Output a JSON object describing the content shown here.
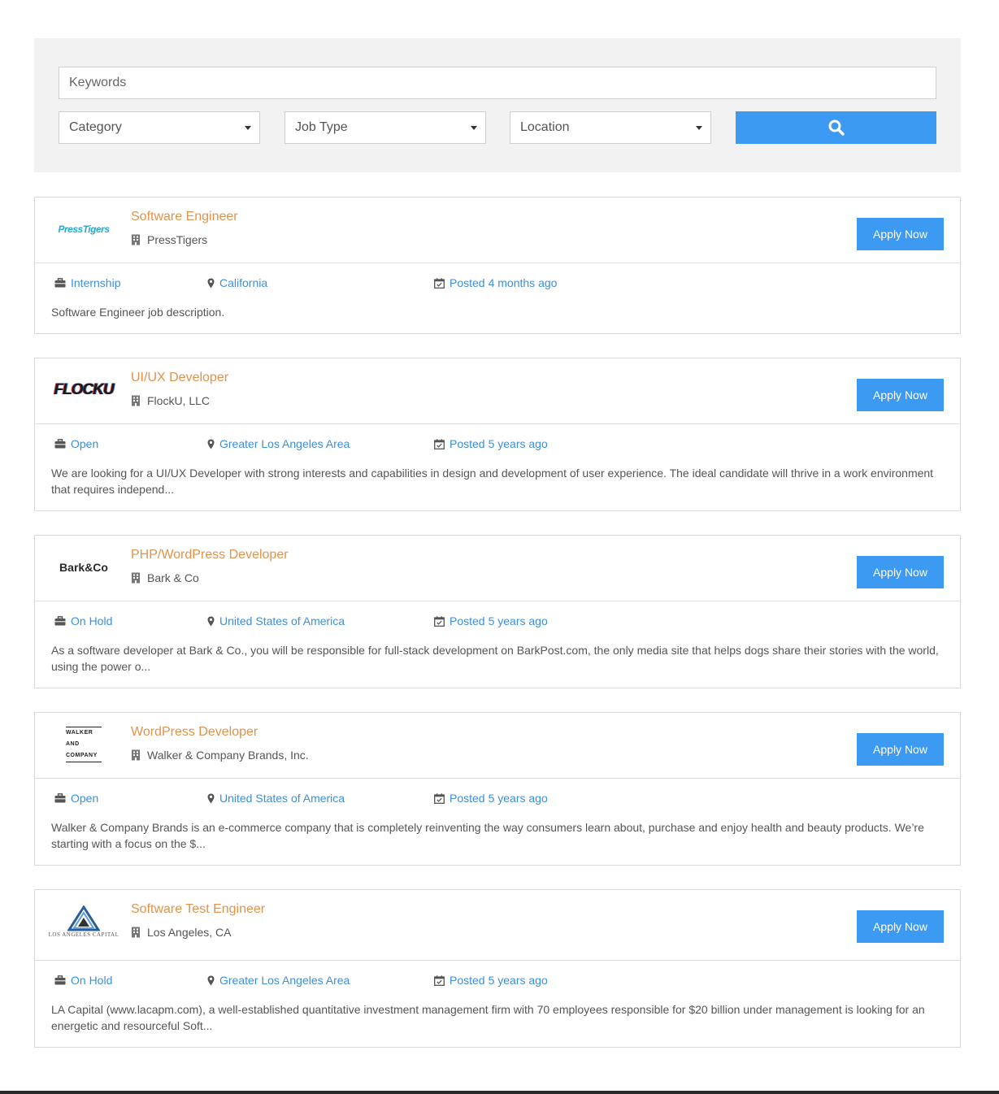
{
  "search": {
    "keywords_placeholder": "Keywords",
    "category_label": "Category",
    "job_type_label": "Job Type",
    "location_label": "Location",
    "search_icon": "search-icon",
    "accent_color": "#3d9af2"
  },
  "jobs": [
    {
      "title": "Software Engineer",
      "company": "PressTigers",
      "logo_text": "PressTigers",
      "apply_label": "Apply Now",
      "type": "Internship",
      "location": "California",
      "posted_prefix": "Posted",
      "posted_ago": "4 months ago",
      "description": "Software Engineer job description."
    },
    {
      "title": "UI/UX Developer",
      "company": "FlockU, LLC",
      "logo_text": "FLOCKU",
      "apply_label": "Apply Now",
      "type": "Open",
      "location": "Greater Los Angeles Area",
      "posted_prefix": "Posted",
      "posted_ago": "5 years ago",
      "description": "We are looking for a UI/UX Developer with strong interests and capabilities in design and development of user experience.  The ideal candidate will thrive in a work environment that requires independ..."
    },
    {
      "title": "PHP/WordPress Developer",
      "company": "Bark & Co",
      "logo_text": "Bark&Co",
      "apply_label": "Apply Now",
      "type": "On Hold",
      "location": "United States of America",
      "posted_prefix": "Posted",
      "posted_ago": "5 years ago",
      "description": "As a software developer at Bark & Co., you will be responsible for full-stack development on BarkPost.com, the only media site that helps dogs share their stories with the world, using the power o..."
    },
    {
      "title": "WordPress Developer",
      "company": "Walker & Company Brands, Inc.",
      "logo_text": "WALKER AND COMPANY",
      "apply_label": "Apply Now",
      "type": "Open",
      "location": "United States of America",
      "posted_prefix": "Posted",
      "posted_ago": "5 years ago",
      "description": "Walker & Company Brands is an e-commerce company that is completely reinventing the way consumers learn about, purchase and enjoy health and beauty products. We’re starting with a focus on the $..."
    },
    {
      "title": "Software Test Engineer",
      "company": "Los Angeles, CA",
      "logo_text": "LOS ANGELES CAPITAL",
      "apply_label": "Apply Now",
      "type": "On Hold",
      "location": "Greater Los Angeles Area",
      "posted_prefix": "Posted",
      "posted_ago": "5 years ago",
      "description": "LA Capital (www.lacapm.com), a well-established quantitative investment management firm with 70 employees responsible for $20 billion under management is looking for an energetic and resourceful Soft..."
    }
  ]
}
